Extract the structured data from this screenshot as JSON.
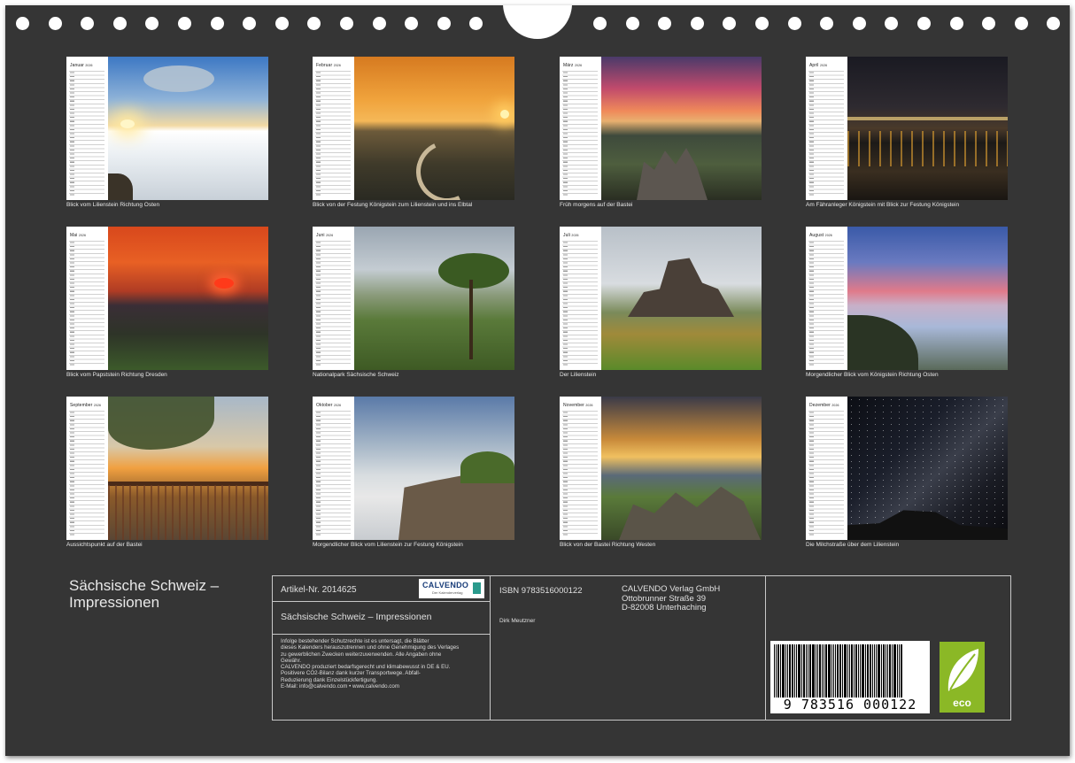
{
  "calendar_title": "Sächsische Schweiz – Impressionen",
  "months": [
    {
      "name": "Januar",
      "year": "2026",
      "caption": "Blick vom Lilienstein Richtung Osten"
    },
    {
      "name": "Februar",
      "year": "2026",
      "caption": "Blick von der Festung Königstein zum Lilienstein und ins Elbtal"
    },
    {
      "name": "März",
      "year": "2026",
      "caption": "Früh morgens auf der Bastei"
    },
    {
      "name": "April",
      "year": "2026",
      "caption": "Am Fähranleger Königstein mit Blick zur Festung Königstein"
    },
    {
      "name": "Mai",
      "year": "2026",
      "caption": "Blick vom Papststein Richtung Dresden"
    },
    {
      "name": "Juni",
      "year": "2026",
      "caption": "Nationalpark Sächsische Schweiz"
    },
    {
      "name": "Juli",
      "year": "2026",
      "caption": "Der Lilienstein"
    },
    {
      "name": "August",
      "year": "2026",
      "caption": "Morgendlicher Blick vom Königstein Richtung Osten"
    },
    {
      "name": "September",
      "year": "2026",
      "caption": "Aussichtspunkt auf der Bastei"
    },
    {
      "name": "Oktober",
      "year": "2026",
      "caption": "Morgendlicher Blick vom Lilienstein zur Festung Königstein"
    },
    {
      "name": "November",
      "year": "2026",
      "caption": "Blick von der Bastei Richtung Westen"
    },
    {
      "name": "Dezember",
      "year": "2026",
      "caption": "Die Milchstraße über dem Lilienstein"
    }
  ],
  "imprint": {
    "article_no": "Artikel-Nr. 2014625",
    "calvendo_logo": "CALVENDO",
    "calvendo_tagline": "Der Kalenderverlag",
    "title": "Sächsische Schweiz – Impressionen",
    "notice": [
      "Infolge bestehender Schutzrechte ist es untersagt, die Blätter",
      "dieses Kalenders herauszutrennen und ohne Genehmigung des Verlages",
      "zu gewerblichen Zwecken weiterzuverwenden. Alle Angaben ohne",
      "Gewähr.",
      "CALVENDO produziert bedarfsgerecht und klimabewusst in DE & EU.",
      "Positivere CO2-Bilanz dank kurzer Transportwege. Abfall-",
      "Reduzierung dank Einzelstückfertigung.",
      "E-Mail: info@calvendo.com • www.calvendo.com"
    ],
    "isbn": "ISBN 9783516000122",
    "publisher": [
      "CALVENDO Verlag GmbH",
      "Ottobrunner Straße 39",
      "D-82008 Unterhaching"
    ],
    "author": "Dirk Meutzner",
    "barcode_number": "9  783516  000122",
    "eco_label": "eco"
  },
  "colors": {
    "sheet": "#353535",
    "eco": "#8bb826",
    "calvendo_blue": "#1a3e7a"
  }
}
